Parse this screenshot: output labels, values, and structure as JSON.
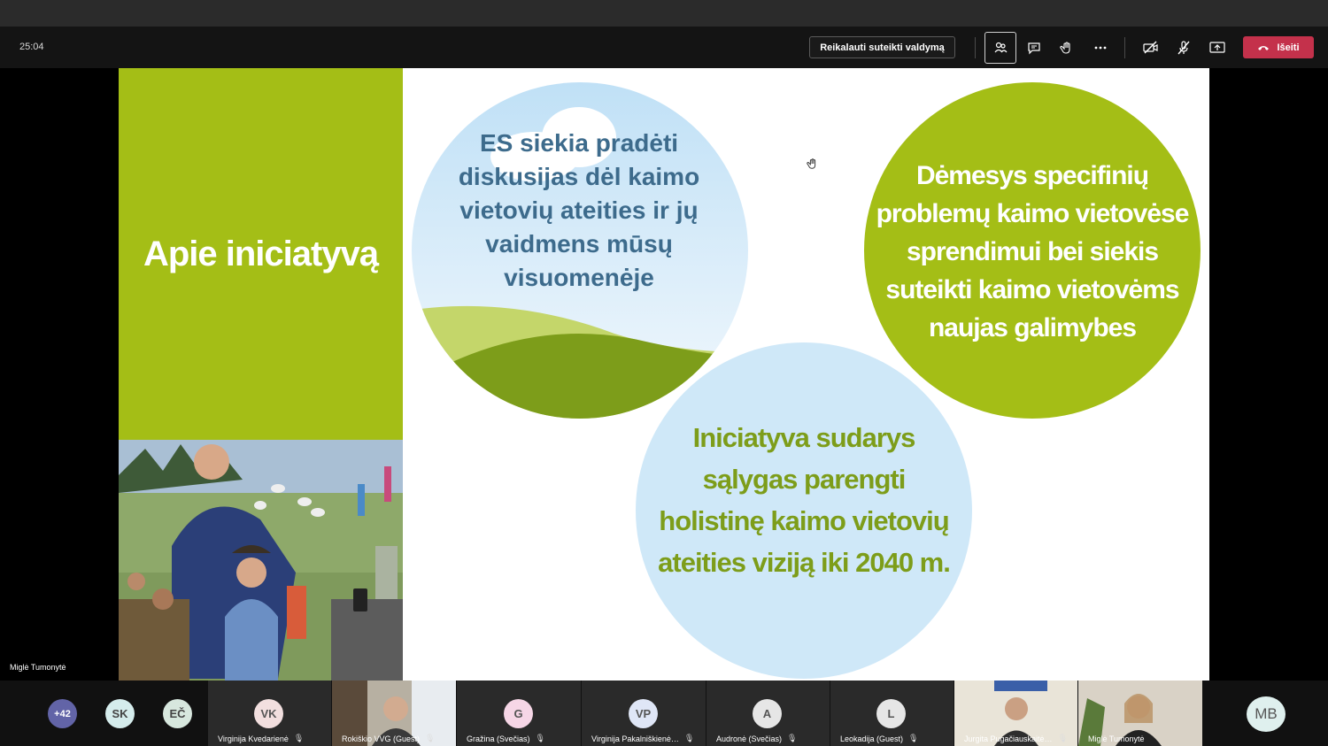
{
  "toolbar": {
    "timer": "25:04",
    "request_control_label": "Reikalauti suteikti valdymą",
    "leave_label": "Išeiti",
    "icons": [
      "participants-icon",
      "chat-icon",
      "raise-hand-icon",
      "more-options-icon",
      "camera-off-icon",
      "mic-off-icon",
      "share-screen-icon",
      "hang-up-icon"
    ]
  },
  "slide": {
    "panel_title": "Apie iniciatyvą",
    "circle_1_text": "ES siekia pradėti diskusijas dėl kaimo vietovių ateities ir jų vaidmens mūsų visuomenėje",
    "circle_2_text": "Dėmesys specifinių problemų kaimo vietovėse sprendimui bei siekis suteikti kaimo vietovėms naujas galimybes",
    "circle_3_text": "Iniciatyva sudarys sąlygas parengti holistinę kaimo vietovių ateities viziją iki 2040 m.",
    "colors": {
      "green": "#a4be16",
      "light_blue": "#cfe8f8",
      "dark_green": "#7d9d1a",
      "blue_text": "#3d6b8c"
    }
  },
  "presenter_name": "Miglė Tumonytė",
  "participants": {
    "overflow": {
      "initials": "+42",
      "color": "#6264a7"
    },
    "small_avatars": [
      {
        "initials": "SK",
        "color": "#d5ecec"
      },
      {
        "initials": "EČ",
        "color": "#d7e7de"
      }
    ],
    "tiles": [
      {
        "initials": "VK",
        "name": "Virginija Kvedarienė",
        "color": "#f2dfdf",
        "video": false
      },
      {
        "initials": "",
        "name": "Rokiškio VVG (Guest)",
        "color": "",
        "video": true
      },
      {
        "initials": "G",
        "name": "Gražina (Svečias)",
        "color": "#f6d6e6",
        "video": false
      },
      {
        "initials": "VP",
        "name": "Virginija Pakalniškienė…",
        "color": "#dfe6f6",
        "video": false
      },
      {
        "initials": "A",
        "name": "Audronė (Svečias)",
        "color": "#e6e6e6",
        "video": false
      },
      {
        "initials": "L",
        "name": "Leokadija (Guest)",
        "color": "#e6e6e6",
        "video": false
      },
      {
        "initials": "",
        "name": "Jurgita Pugačiauskaitė…",
        "color": "",
        "video": true
      },
      {
        "initials": "",
        "name": "Miglė Tumonytė",
        "color": "",
        "video": true
      }
    ],
    "self": {
      "initials": "MB",
      "color": "#dff0ee"
    }
  }
}
